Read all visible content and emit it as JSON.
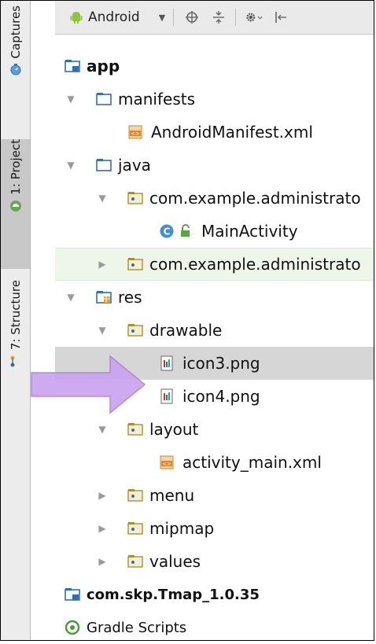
{
  "side_tabs": {
    "captures": "Captures",
    "project": "1: Project",
    "structure": "7: Structure"
  },
  "toolbar": {
    "view_mode": "Android"
  },
  "tree": {
    "app": "app",
    "manifests": "manifests",
    "manifest_file": "AndroidManifest.xml",
    "java": "java",
    "pkg1": "com.example.administrato",
    "main_activity": "MainActivity",
    "pkg2": "com.example.administrato",
    "res": "res",
    "drawable": "drawable",
    "icon3": "icon3.png",
    "icon4": "icon4.png",
    "layout": "layout",
    "activity_main": "activity_main.xml",
    "menu": "menu",
    "mipmap": "mipmap",
    "values": "values",
    "lib_module": "com.skp.Tmap_1.0.35",
    "gradle": "Gradle Scripts"
  },
  "colors": {
    "folder_blue": "#2f6fb6",
    "selection": "#d6d6d6",
    "hint_arrow": "#c9a3ef"
  }
}
